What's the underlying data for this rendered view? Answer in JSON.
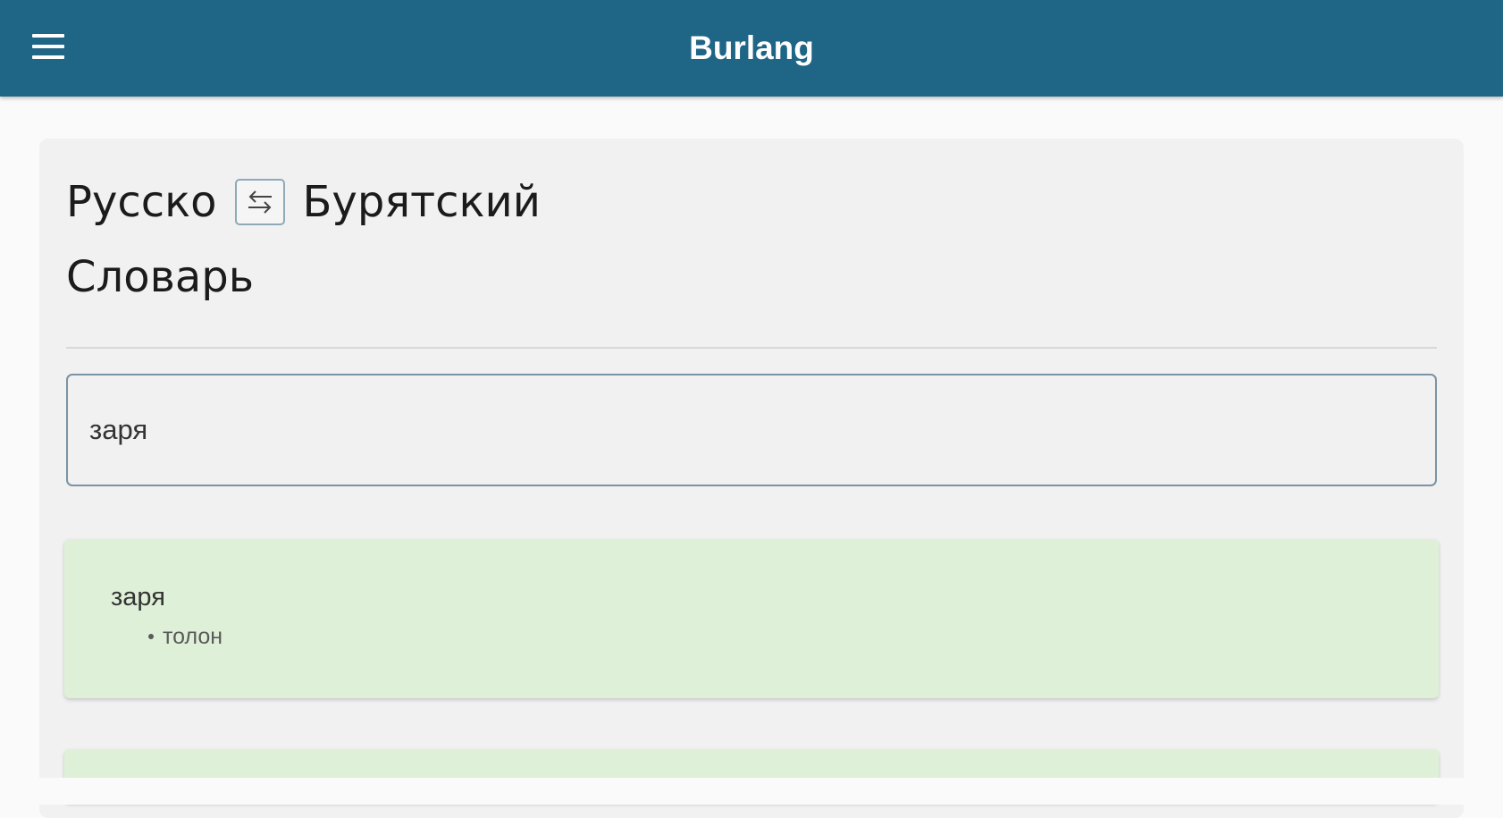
{
  "app_bar": {
    "title": "Burlang",
    "menu_icon": "hamburger-menu-icon",
    "color": "#1f6586"
  },
  "dictionary": {
    "source_language": "Русско",
    "target_language": "Бурятский",
    "swap_icon": "swap-arrows-icon",
    "subtitle": "Словарь"
  },
  "search": {
    "value": "заря",
    "placeholder": ""
  },
  "results": [
    {
      "word": "заря",
      "translations": [
        "толон"
      ],
      "background": "#dff0d8"
    }
  ]
}
